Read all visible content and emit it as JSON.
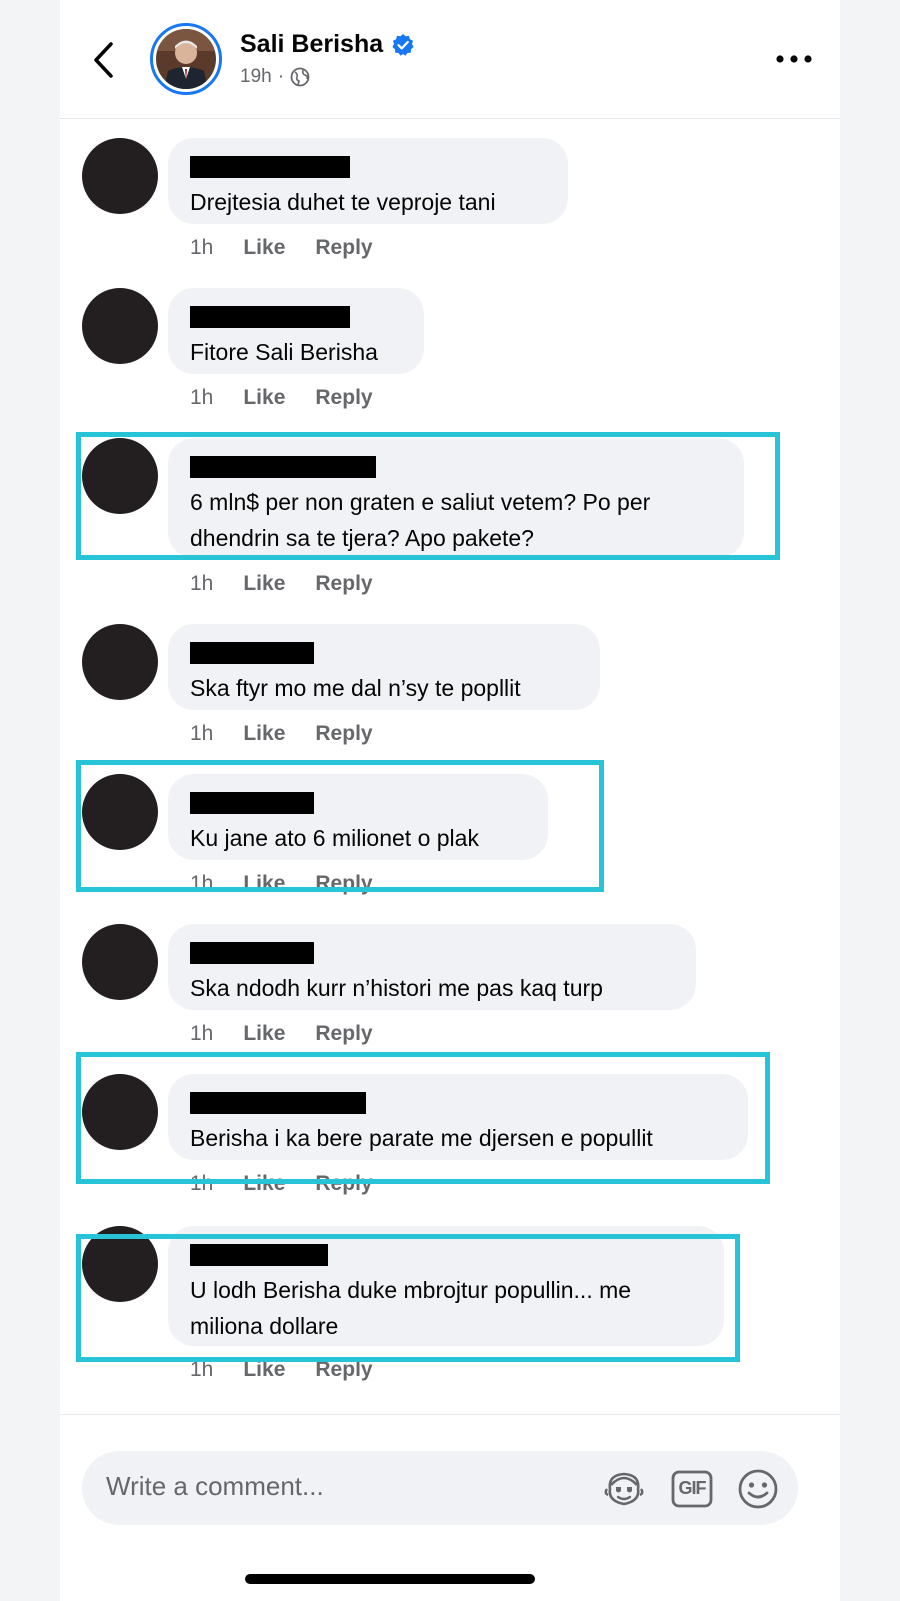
{
  "header": {
    "page_name": "Sali Berisha",
    "time": "19h",
    "separator": "·",
    "audience_icon": "globe-icon",
    "verified_icon": "verified-badge-icon",
    "back_icon": "chevron-left-icon",
    "more_icon": "more-icon"
  },
  "comments": [
    {
      "text": "Drejtesia duhet te veproje tani",
      "time": "1h",
      "like": "Like",
      "reply": "Reply"
    },
    {
      "text": "Fitore Sali Berisha",
      "time": "1h",
      "like": "Like",
      "reply": "Reply"
    },
    {
      "text": "6 mln$ per non graten e saliut vetem? Po per dhendrin sa te tjera? Apo pakete?",
      "time": "1h",
      "like": "Like",
      "reply": "Reply"
    },
    {
      "text": "Ska ftyr mo me dal n’sy te popllit",
      "time": "1h",
      "like": "Like",
      "reply": "Reply"
    },
    {
      "text": "Ku jane ato 6 milionet o plak",
      "time": "1h",
      "like": "Like",
      "reply": "Reply"
    },
    {
      "text": "Ska ndodh kurr n’histori me pas kaq turp",
      "time": "1h",
      "like": "Like",
      "reply": "Reply"
    },
    {
      "text": "Berisha i ka bere parate me djersen e popullit",
      "time": "1h",
      "like": "Like",
      "reply": "Reply"
    },
    {
      "text": "U lodh Berisha duke mbrojtur popullin... me miliona dollare",
      "time": "1h",
      "like": "Like",
      "reply": "Reply"
    }
  ],
  "composer": {
    "placeholder": "Write a comment...",
    "icons": [
      "avatar-sticker-icon",
      "gif-icon",
      "emoji-icon"
    ],
    "gif_label": "GIF"
  },
  "colors": {
    "highlight": "#27c3d6",
    "verified": "#1877f2",
    "bubble": "#f0f2f5",
    "secondary_text": "#65676b"
  }
}
